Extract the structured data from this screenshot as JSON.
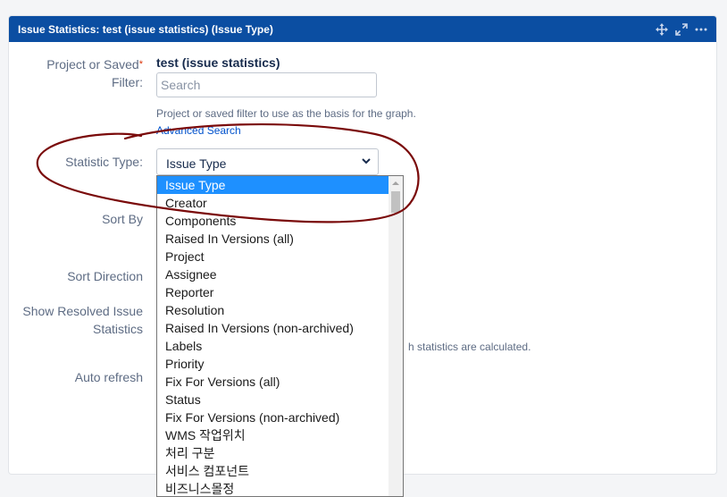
{
  "header": {
    "title": "Issue Statistics: test (issue statistics) (Issue Type)"
  },
  "form": {
    "project_label_line1": "Project or Saved",
    "project_label_line2": "Filter:",
    "required_mark": "*",
    "filter_name": "test (issue statistics)",
    "search_placeholder": "Search",
    "search_value": "",
    "filter_help": "Project or saved filter to use as the basis for the graph.",
    "advanced_search_link": "Advanced Search",
    "statistic_type_label": "Statistic Type:",
    "statistic_type_value": "Issue Type",
    "sort_by_label": "Sort By",
    "sort_direction_label": "Sort Direction",
    "show_resolved_line1": "Show Resolved Issue",
    "show_resolved_line2": "Statistics",
    "show_resolved_help_fragment": "h statistics are calculated.",
    "auto_refresh_label": "Auto refresh"
  },
  "dropdown": {
    "options": [
      "Issue Type",
      "Creator",
      "Components",
      "Raised In Versions (all)",
      "Project",
      "Assignee",
      "Reporter",
      "Resolution",
      "Raised In Versions (non-archived)",
      "Labels",
      "Priority",
      "Fix For Versions (all)",
      "Status",
      "Fix For Versions (non-archived)",
      "WMS 작업위치",
      "처리 구분",
      "서비스 컴포넌트",
      "비즈니스몰정"
    ],
    "selected_index": 0
  },
  "colors": {
    "header_bg": "#0b4ea2",
    "selected_option": "#1e90ff",
    "link": "#0052cc",
    "annotation": "#7a0a0a"
  }
}
